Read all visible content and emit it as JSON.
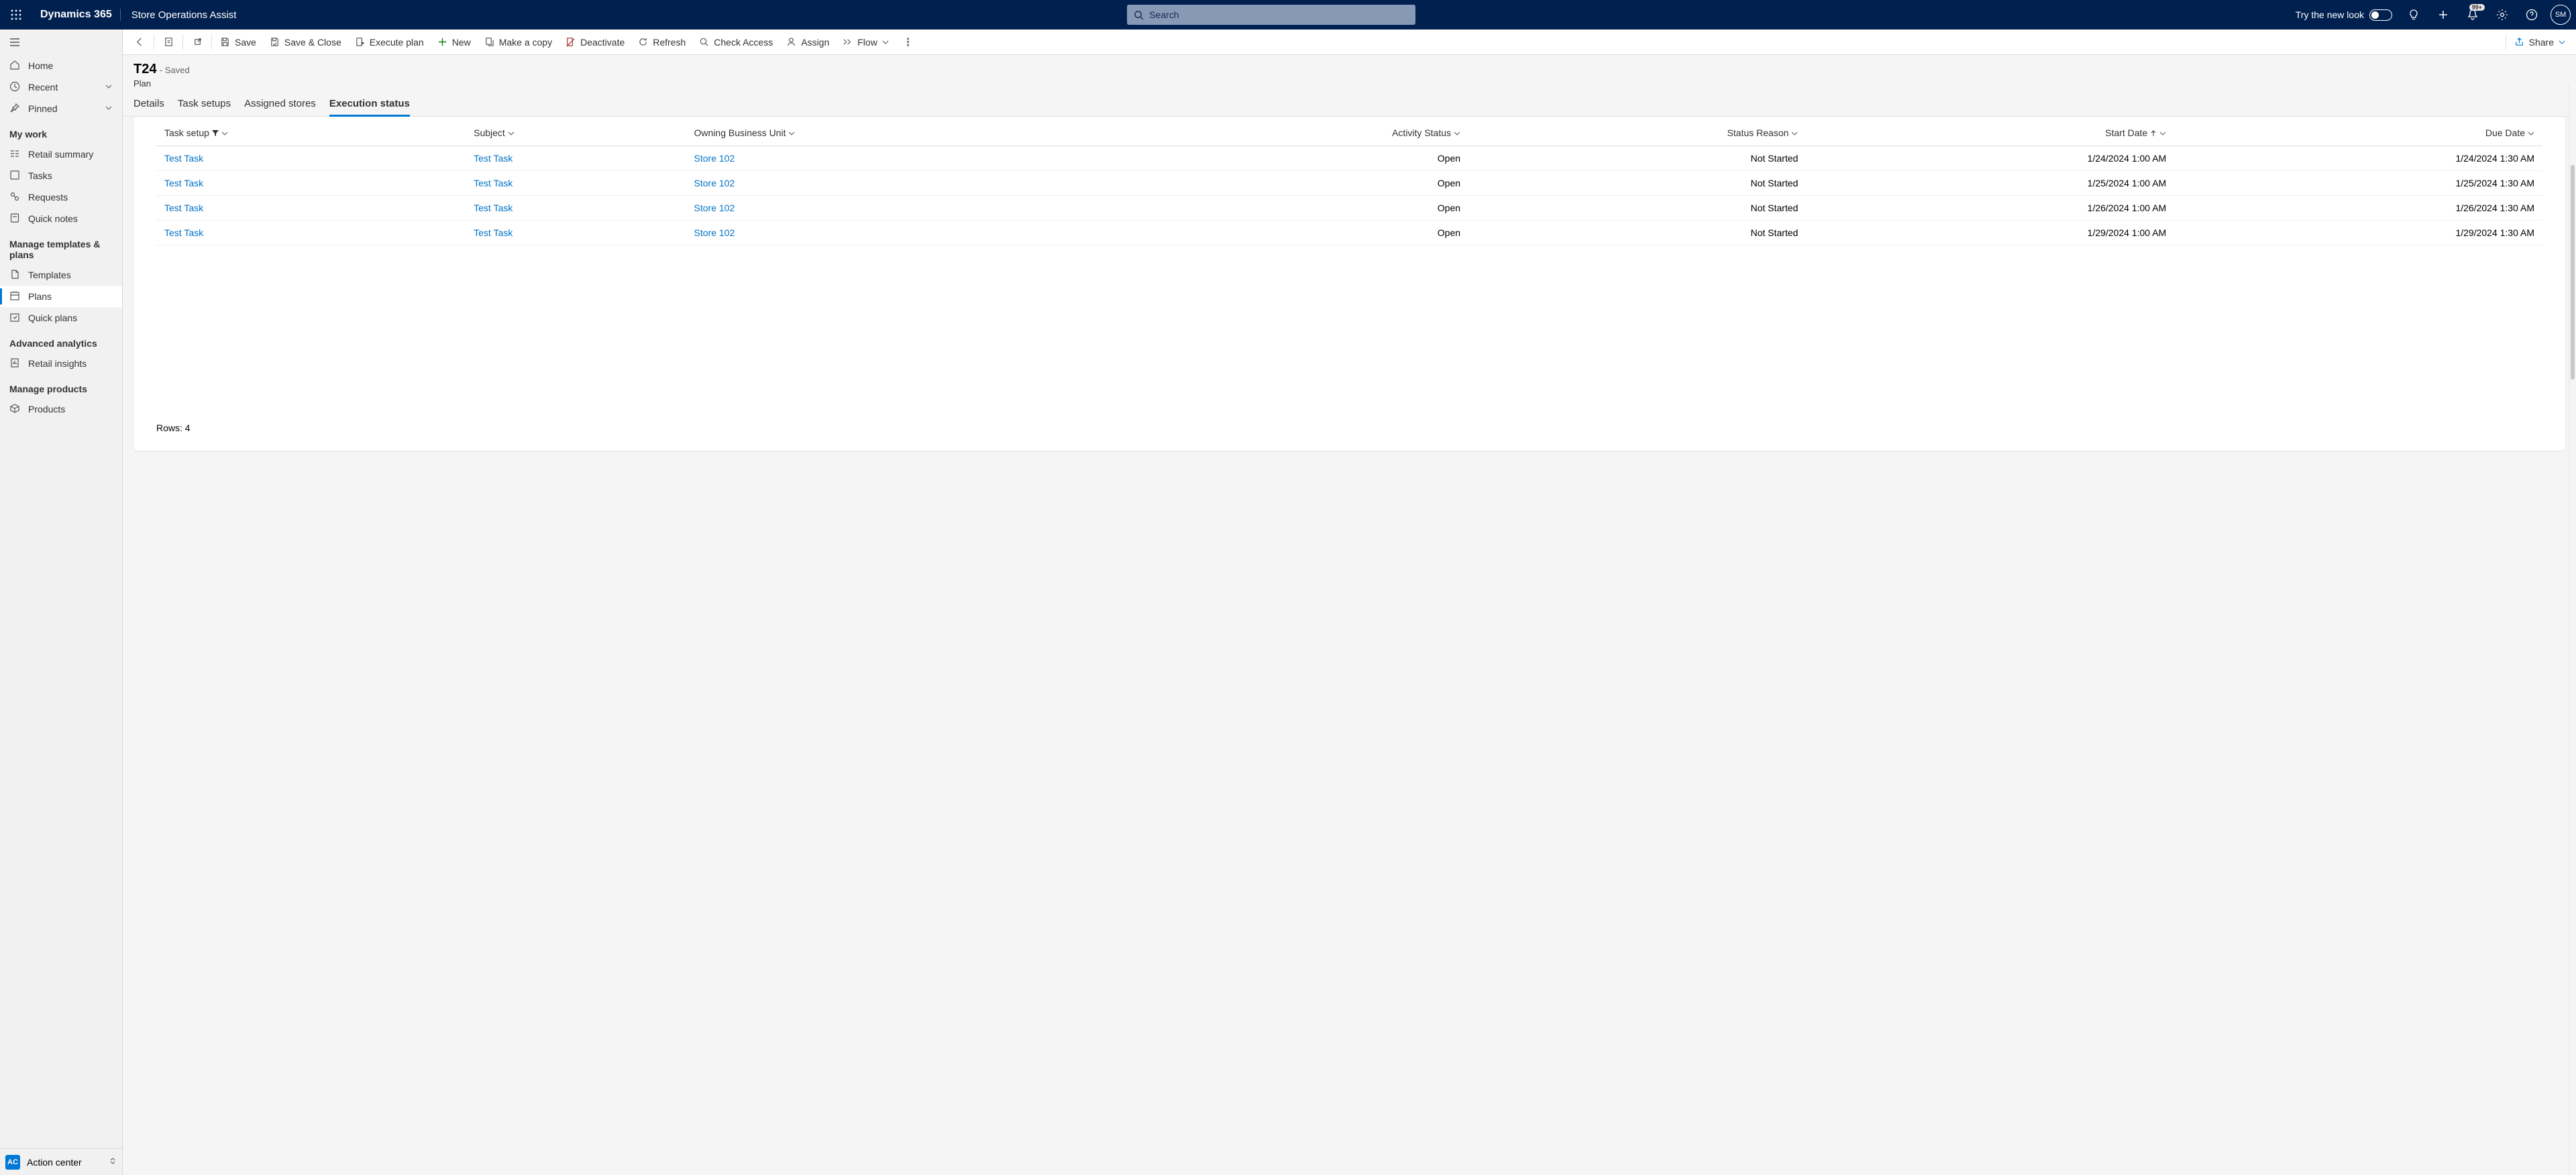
{
  "header": {
    "brand": "Dynamics 365",
    "app_name": "Store Operations Assist",
    "search_placeholder": "Search",
    "new_look_label": "Try the new look",
    "notification_badge": "99+",
    "user_initials": "SM"
  },
  "sidebar": {
    "items": [
      {
        "icon": "home",
        "label": "Home"
      },
      {
        "icon": "clock",
        "label": "Recent",
        "expandable": true
      },
      {
        "icon": "pin",
        "label": "Pinned",
        "expandable": true
      }
    ],
    "sections": [
      {
        "header": "My work",
        "items": [
          {
            "icon": "summary",
            "label": "Retail summary"
          },
          {
            "icon": "tasks",
            "label": "Tasks"
          },
          {
            "icon": "requests",
            "label": "Requests"
          },
          {
            "icon": "notes",
            "label": "Quick notes"
          }
        ]
      },
      {
        "header": "Manage templates & plans",
        "items": [
          {
            "icon": "template",
            "label": "Templates"
          },
          {
            "icon": "plan",
            "label": "Plans",
            "active": true
          },
          {
            "icon": "quickplan",
            "label": "Quick plans"
          }
        ]
      },
      {
        "header": "Advanced analytics",
        "items": [
          {
            "icon": "insights",
            "label": "Retail insights"
          }
        ]
      },
      {
        "header": "Manage products",
        "items": [
          {
            "icon": "products",
            "label": "Products"
          }
        ]
      }
    ],
    "bottom": {
      "badge": "AC",
      "label": "Action center"
    }
  },
  "commandbar": {
    "save": "Save",
    "save_close": "Save & Close",
    "execute": "Execute plan",
    "new": "New",
    "copy": "Make a copy",
    "deactivate": "Deactivate",
    "refresh": "Refresh",
    "check_access": "Check Access",
    "assign": "Assign",
    "flow": "Flow",
    "share": "Share"
  },
  "record": {
    "title": "T24",
    "saved": "- Saved",
    "entity": "Plan",
    "tabs": [
      "Details",
      "Task setups",
      "Assigned stores",
      "Execution status"
    ],
    "active_tab": 3
  },
  "grid": {
    "columns": [
      "Task setup",
      "Subject",
      "Owning Business Unit",
      "Activity Status",
      "Status Reason",
      "Start Date",
      "Due Date"
    ],
    "rows": [
      {
        "task_setup": "Test Task",
        "subject": "Test Task",
        "obu": "Store 102",
        "status": "Open",
        "reason": "Not Started",
        "start": "1/24/2024 1:00 AM",
        "due": "1/24/2024 1:30 AM"
      },
      {
        "task_setup": "Test Task",
        "subject": "Test Task",
        "obu": "Store 102",
        "status": "Open",
        "reason": "Not Started",
        "start": "1/25/2024 1:00 AM",
        "due": "1/25/2024 1:30 AM"
      },
      {
        "task_setup": "Test Task",
        "subject": "Test Task",
        "obu": "Store 102",
        "status": "Open",
        "reason": "Not Started",
        "start": "1/26/2024 1:00 AM",
        "due": "1/26/2024 1:30 AM"
      },
      {
        "task_setup": "Test Task",
        "subject": "Test Task",
        "obu": "Store 102",
        "status": "Open",
        "reason": "Not Started",
        "start": "1/29/2024 1:00 AM",
        "due": "1/29/2024 1:30 AM"
      }
    ],
    "footer": "Rows: 4"
  }
}
